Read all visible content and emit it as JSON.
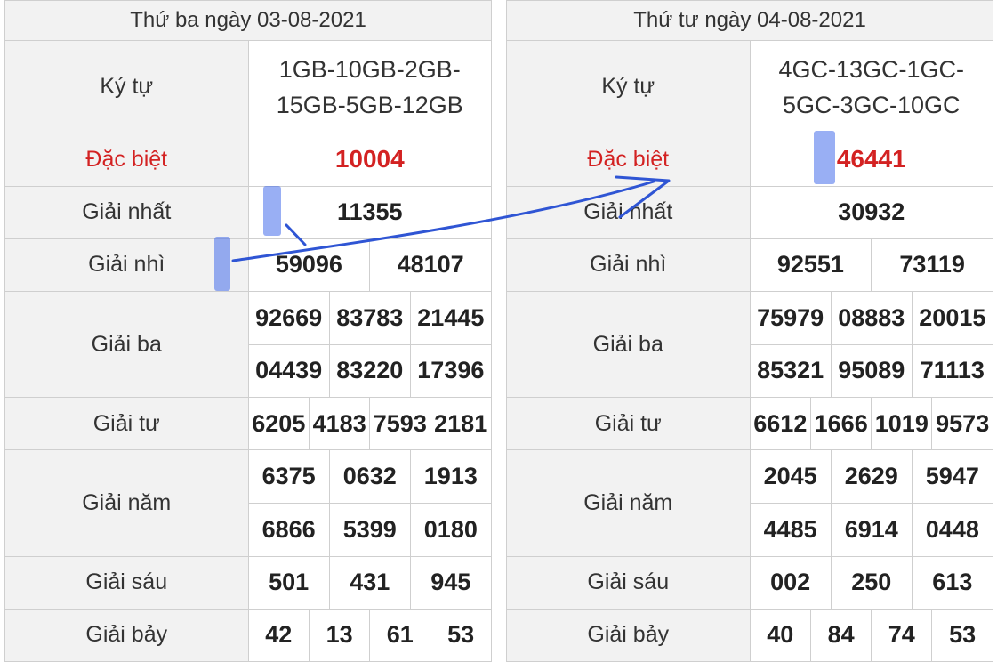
{
  "left": {
    "title": "Thứ ba ngày 03-08-2021",
    "rows": [
      {
        "label": "Ký tự",
        "stations": "1GB-10GB-2GB-15GB-5GB-12GB"
      },
      {
        "label": "Đặc biệt",
        "values": [
          "10004"
        ]
      },
      {
        "label": "Giải nhất",
        "values": [
          "11355"
        ]
      },
      {
        "label": "Giải nhì",
        "values": [
          "59096",
          "48107"
        ]
      },
      {
        "label": "Giải ba",
        "values": [
          "92669",
          "83783",
          "21445",
          "04439",
          "83220",
          "17396"
        ]
      },
      {
        "label": "Giải tư",
        "values": [
          "6205",
          "4183",
          "7593",
          "2181"
        ]
      },
      {
        "label": "Giải năm",
        "values": [
          "6375",
          "0632",
          "1913",
          "6866",
          "5399",
          "0180"
        ]
      },
      {
        "label": "Giải sáu",
        "values": [
          "501",
          "431",
          "945"
        ]
      },
      {
        "label": "Giải bảy",
        "values": [
          "42",
          "13",
          "61",
          "53"
        ]
      }
    ]
  },
  "right": {
    "title": "Thứ tư ngày 04-08-2021",
    "rows": [
      {
        "label": "Ký tự",
        "stations": "4GC-13GC-1GC-5GC-3GC-10GC"
      },
      {
        "label": "Đặc biệt",
        "values": [
          "46441"
        ]
      },
      {
        "label": "Giải nhất",
        "values": [
          "30932"
        ]
      },
      {
        "label": "Giải nhì",
        "values": [
          "92551",
          "73119"
        ]
      },
      {
        "label": "Giải ba",
        "values": [
          "75979",
          "08883",
          "20015",
          "85321",
          "95089",
          "71113"
        ]
      },
      {
        "label": "Giải tư",
        "values": [
          "6612",
          "1666",
          "1019",
          "9573"
        ]
      },
      {
        "label": "Giải năm",
        "values": [
          "2045",
          "2629",
          "5947",
          "4485",
          "6914",
          "0448"
        ]
      },
      {
        "label": "Giải sáu",
        "values": [
          "002",
          "250",
          "613"
        ]
      },
      {
        "label": "Giải bảy",
        "values": [
          "40",
          "84",
          "74",
          "53"
        ]
      }
    ]
  },
  "colors": {
    "special_red": "#d32222",
    "highlight": "#466eeb",
    "arrow": "#2f55d4",
    "label_bg": "#f2f2f2",
    "border": "#cfcfcf"
  }
}
